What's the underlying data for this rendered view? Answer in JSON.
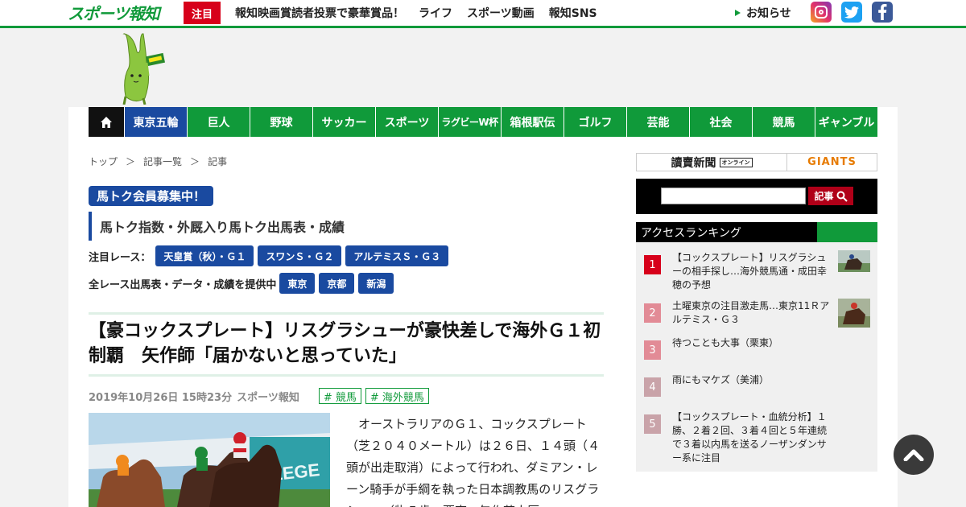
{
  "header": {
    "logo": "スポーツ報知",
    "highlight_badge": "注目",
    "nav": [
      "報知映画賞読者投票で豪華賞品！",
      "ライフ",
      "スポーツ動画",
      "報知SNS"
    ],
    "notice": "お知らせ",
    "social_icons": [
      "instagram-icon",
      "twitter-icon",
      "facebook-icon"
    ]
  },
  "main_nav": {
    "home_icon": "home-icon",
    "items": [
      "東京五輪",
      "巨人",
      "野球",
      "サッカー",
      "スポーツ",
      "ラグビーW杯",
      "箱根駅伝",
      "ゴルフ",
      "芸能",
      "社会",
      "競馬",
      "ギャンブル"
    ],
    "active_index": 0
  },
  "breadcrumb": [
    "トップ",
    "＞",
    "記事一覧",
    "＞",
    "記事"
  ],
  "umatoku": {
    "badge": "馬トク会員募集中！",
    "subtitle": "馬トク指数・外厩入り馬トク出馬表・成績",
    "featured_label": "注目レース：",
    "featured_races": [
      "天皇賞（秋）・Ｇ１",
      "スワンＳ・Ｇ２",
      "アルテミスＳ・Ｇ３"
    ],
    "all_races_label": "全レース出馬表・データ・成績を提供中",
    "venues": [
      "東京",
      "京都",
      "新潟"
    ]
  },
  "article": {
    "headline": "【豪コックスプレート】リスグラシューが豪快差しで海外Ｇ１初制覇　矢作師「届かないと思っていた」",
    "date": "2019年10月26日 15時23分",
    "source": "スポーツ報知",
    "tags": [
      "# 競馬",
      "# 海外競馬"
    ],
    "body": "オーストラリアのＧ１、コックスプレート（芝２０４０メートル）は２６日、１４頭（４頭が出走取消）によって行われ、ダミアン・レーン騎手が手綱を執った日本調教馬のリスグラシュー（牝５歳、栗東・矢作芳人厩"
  },
  "sidebar": {
    "banner_left": "讀賣新聞",
    "banner_left_badge": "オンライン",
    "banner_right": "GIANTS",
    "search_button": "記事",
    "ranking_title": "アクセスランキング",
    "ranking": [
      {
        "rank": "1",
        "title": "【コックスプレート】リスグラシューの相手探し…海外競馬通・成田幸穂の予想"
      },
      {
        "rank": "2",
        "title": "土曜東京の注目激走馬…東京11Ｒアルテミス・Ｇ３"
      },
      {
        "rank": "3",
        "title": "待つことも大事（栗東）"
      },
      {
        "rank": "4",
        "title": "雨にもマケズ（美浦）"
      },
      {
        "rank": "5",
        "title": "【コックスプレート・血統分析】１勝、２着２回、３着４回と５年連続で３着以内馬を送るノーザンダンサー系に注目"
      }
    ]
  },
  "colors": {
    "brand_green": "#109a3a",
    "accent_blue": "#1a4aa0",
    "highlight_red": "#d7001a"
  }
}
